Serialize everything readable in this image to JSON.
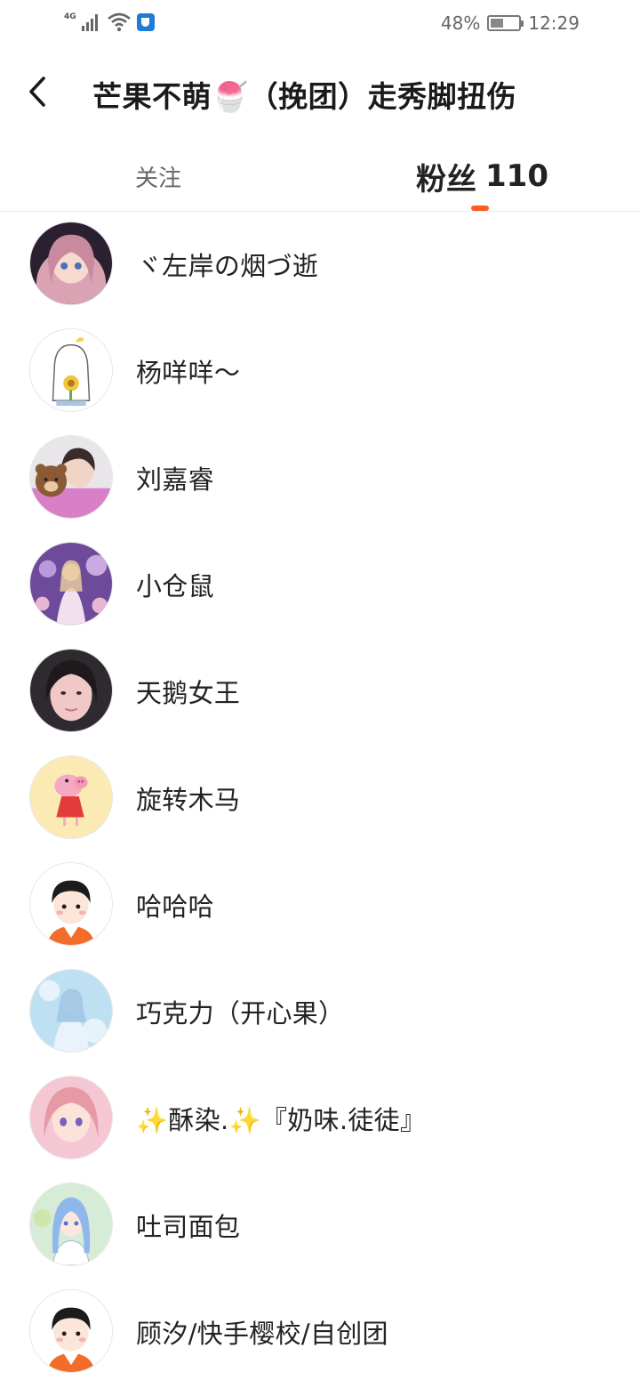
{
  "status_bar": {
    "network": "4G",
    "battery": "48%",
    "battery_level": 0.48,
    "time": "12:29"
  },
  "header": {
    "back_icon": "chevron-left-icon",
    "title": "芒果不萌🍧（挽团）走秀脚扭伤"
  },
  "tabs": {
    "follow_label": "关注",
    "fans_label": "粉丝",
    "fans_count": "110",
    "active": "fans",
    "accent_color": "#ff5a1f"
  },
  "fans": [
    {
      "name": "ヾ左岸の烟づ逝",
      "avatar": "anime-girl-pink-hair-avatar"
    },
    {
      "name": "杨咩咩～",
      "avatar": "cartoon-sunflower-avatar"
    },
    {
      "name": "刘嘉睿",
      "avatar": "girl-with-bear-sticker-avatar"
    },
    {
      "name": "小仓鼠",
      "avatar": "anime-princess-purple-avatar"
    },
    {
      "name": "天鹅女王",
      "avatar": "girl-selfie-avatar"
    },
    {
      "name": "旋转木马",
      "avatar": "peppa-pig-avatar"
    },
    {
      "name": "哈哈哈",
      "avatar": "default-cartoon-person-avatar"
    },
    {
      "name": "巧克力（开心果）",
      "avatar": "anime-blue-fairy-avatar"
    },
    {
      "name": "✨酥染.✨『奶味.徒徒』",
      "avatar": "anime-girl-pink-hair-avatar-2"
    },
    {
      "name": "吐司面包",
      "avatar": "anime-blue-hair-girl-avatar"
    },
    {
      "name": "顾汐/快手樱校/自创团",
      "avatar": "default-cartoon-person-avatar"
    }
  ]
}
